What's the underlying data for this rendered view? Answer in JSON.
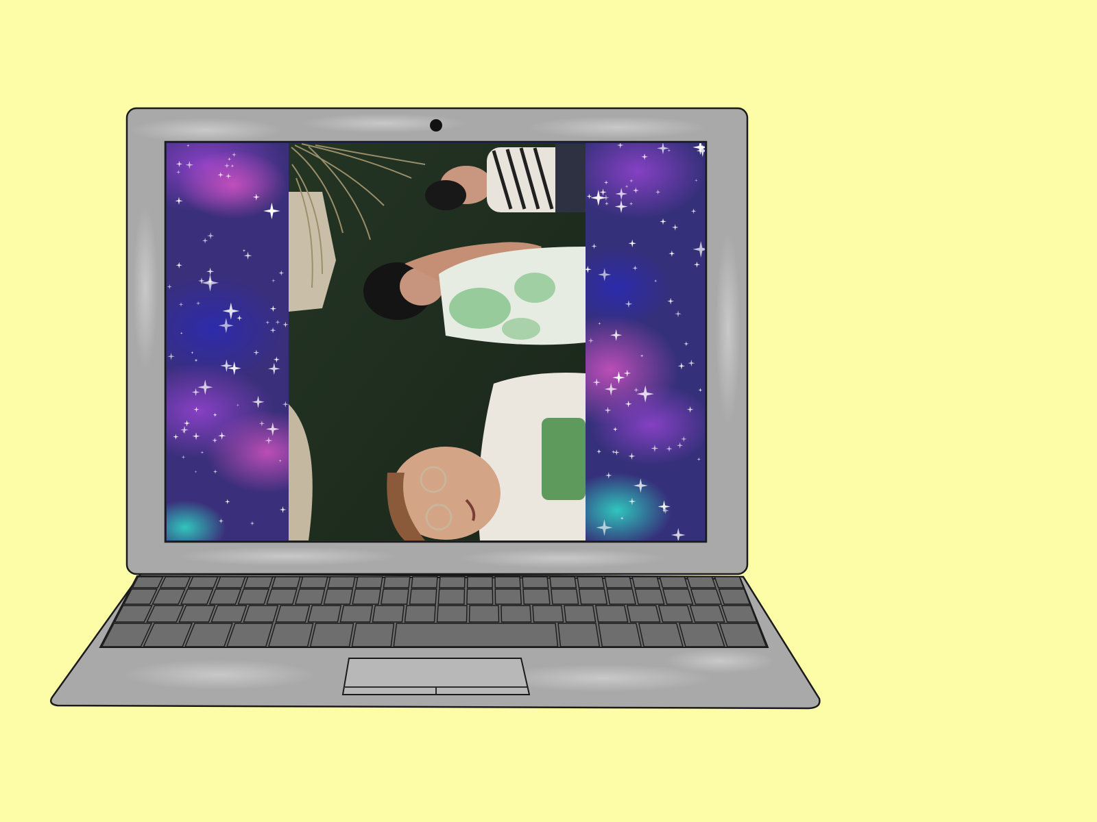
{
  "background_color": "#fdfda8",
  "laptop": {
    "body_color": "#a9a9a9",
    "outline_color": "#1a1a1a",
    "keyboard_key_color": "#6e6e6e",
    "trackpad_color": "#b8b8b8",
    "webcam_color": "#111111"
  },
  "screen": {
    "wallpaper_style": "galaxy",
    "wallpaper_colors": [
      "#3a2f7a",
      "#7a3aa6",
      "#c14fb0",
      "#2fd0c0"
    ],
    "photo_subject": "people-lying-on-artificial-grass-selfie",
    "photo_colors": [
      "#1f2e1f",
      "#2c3d2a",
      "#e9e4dc",
      "#8fc893",
      "#c79a7c"
    ]
  },
  "icons": [
    "webcam-icon",
    "trackpad-icon"
  ]
}
